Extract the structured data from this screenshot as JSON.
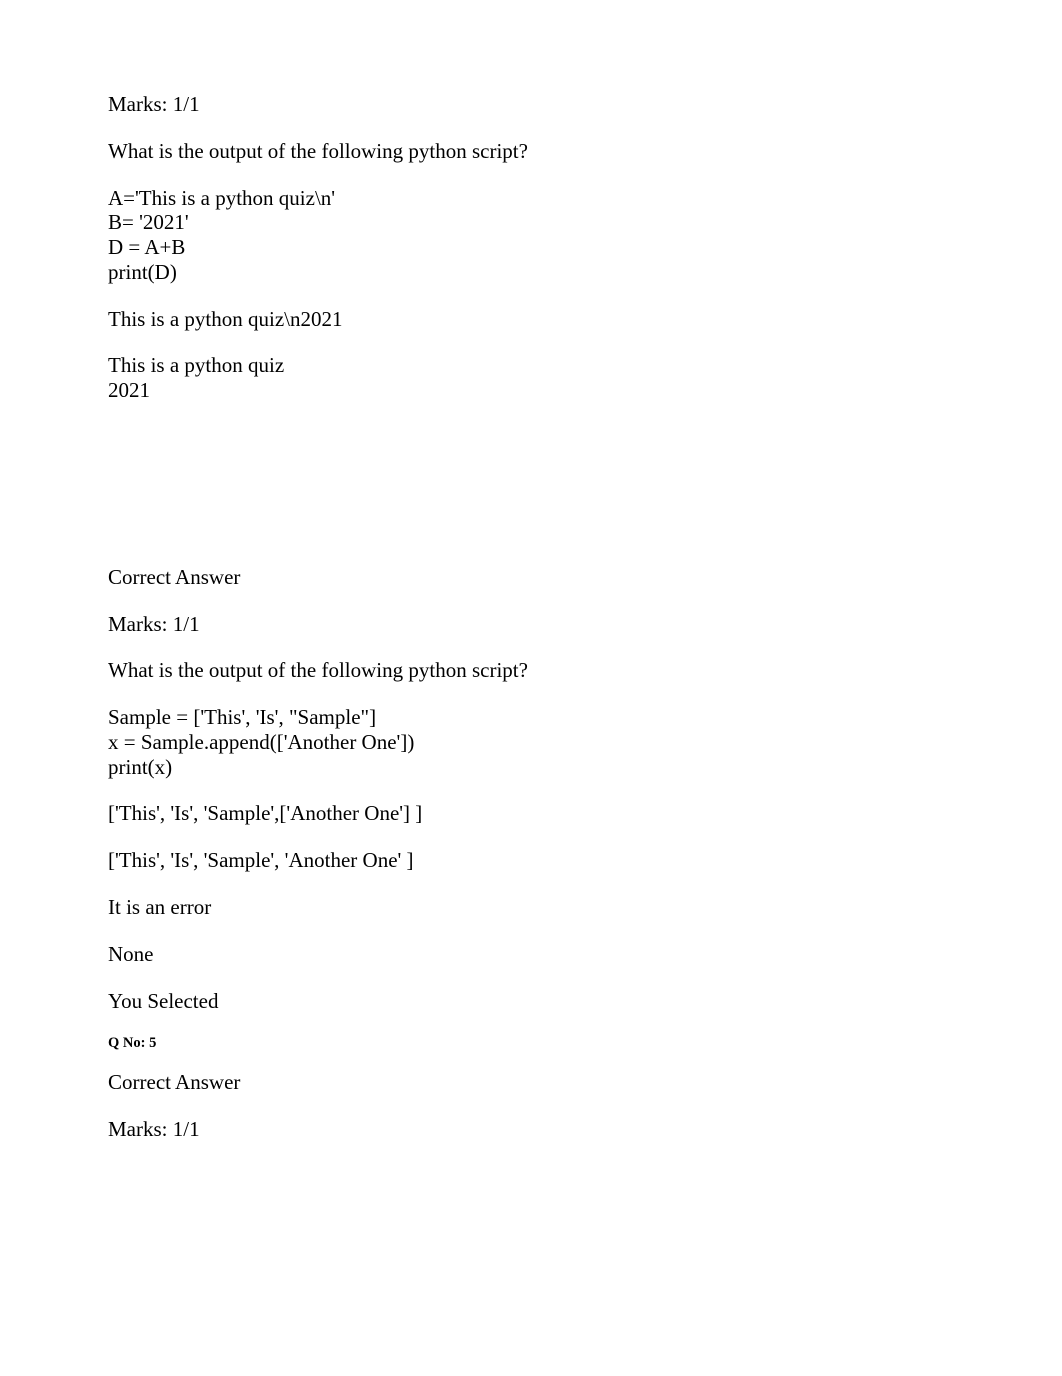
{
  "q3": {
    "marks": "Marks: 1/1",
    "prompt": "What is the output of the following python script?",
    "code": [
      "A='This is a python quiz\\n'",
      "B= '2021'",
      "D = A+B",
      "print(D)"
    ],
    "opt1": "This is a python quiz\\n2021",
    "opt2": [
      "This is a python quiz",
      "2021"
    ]
  },
  "q4": {
    "correct": "Correct Answer",
    "marks": "Marks: 1/1",
    "prompt": "What is the output of the following python script?",
    "code": [
      "Sample = ['This', 'Is', \"Sample\"]",
      "x = Sample.append(['Another One'])",
      "print(x)"
    ],
    "opt1": "['This', 'Is', 'Sample',['Another One'] ]",
    "opt2": "['This', 'Is', 'Sample', 'Another One' ]",
    "opt3": "It is an error",
    "opt4": "None",
    "selected": "You Selected"
  },
  "q5": {
    "qno": "Q No: 5",
    "correct": "Correct Answer",
    "marks": "Marks: 1/1"
  }
}
